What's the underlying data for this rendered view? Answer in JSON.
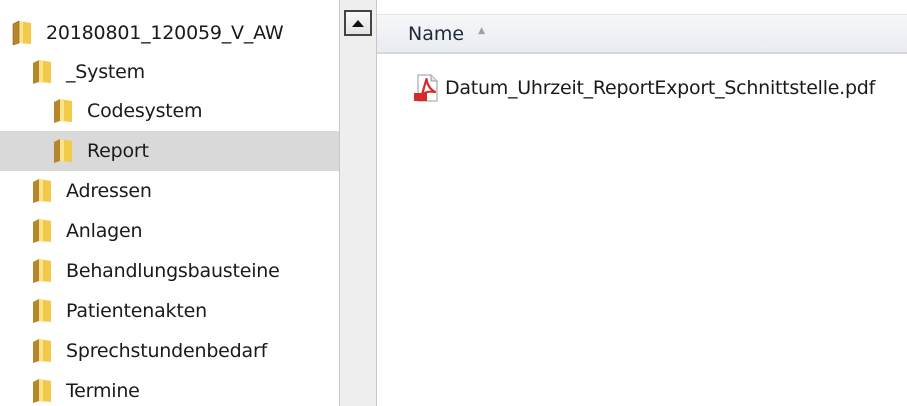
{
  "tree": {
    "items": [
      {
        "label": "20180801_120059_V_AW",
        "selected": false
      },
      {
        "label": "_System",
        "selected": false
      },
      {
        "label": "Codesystem",
        "selected": false
      },
      {
        "label": "Report",
        "selected": true
      },
      {
        "label": "Adressen",
        "selected": false
      },
      {
        "label": "Anlagen",
        "selected": false
      },
      {
        "label": "Behandlungsbausteine",
        "selected": false
      },
      {
        "label": "Patientenakten",
        "selected": false
      },
      {
        "label": "Sprechstundenbedarf",
        "selected": false
      },
      {
        "label": "Termine",
        "selected": false
      }
    ],
    "folder_icon": "folder-icon"
  },
  "content": {
    "columns": [
      {
        "label": "Name",
        "sort": "ascending"
      }
    ],
    "files": [
      {
        "name": "Datum_Uhrzeit_ReportExport_Schnittstelle.pdf",
        "icon": "pdf-file-icon"
      }
    ]
  },
  "colors": {
    "selection": "#d9d9d9",
    "folder": "#e8b93a",
    "pdf": "#d62b2b"
  }
}
